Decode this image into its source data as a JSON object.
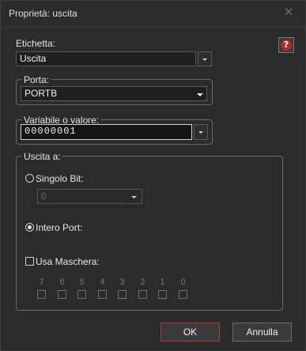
{
  "window": {
    "title": "Proprietà: uscita",
    "close_glyph": "✕"
  },
  "etichetta": {
    "label": "Etichetta:",
    "value": "Uscita"
  },
  "porta": {
    "label": "Porta:",
    "value": "PORTB"
  },
  "variabile": {
    "label": "Variabile o valore:",
    "value": "00000001"
  },
  "uscita": {
    "label": "Uscita a:",
    "singolo_bit": {
      "label": "Singolo Bit:",
      "value": "0",
      "checked": false
    },
    "intero_port": {
      "label": "Intero Port:",
      "checked": true
    },
    "usa_maschera": {
      "label": "Usa Maschera:",
      "checked": false
    },
    "bits": [
      "7",
      "6",
      "5",
      "4",
      "3",
      "2",
      "1",
      "0"
    ]
  },
  "buttons": {
    "ok": "OK",
    "annulla": "Annulla"
  },
  "help": {
    "glyph": "?",
    "icon": "help-icon"
  },
  "colors": {
    "accent_ok_border": "#c0353a",
    "help_red": "#b22a2a",
    "background": "#2b2b2b"
  }
}
